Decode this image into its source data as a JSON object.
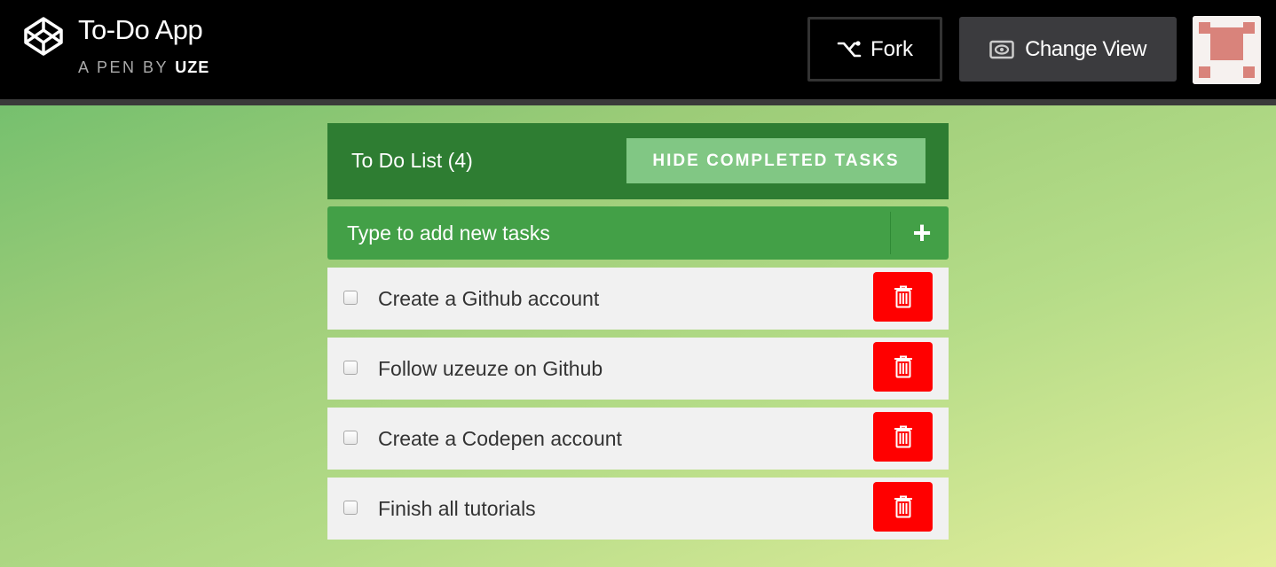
{
  "header": {
    "app_title": "To-Do App",
    "pen_by_prefix": "A PEN BY",
    "author": "UZE",
    "fork_label": "Fork",
    "change_view_label": "Change View"
  },
  "todo": {
    "title": "To Do List (4)",
    "hide_completed_label": "HIDE COMPLETED TASKS",
    "add_placeholder": "Type to add new tasks",
    "add_button_symbol": "+",
    "tasks": [
      {
        "text": "Create a Github account",
        "done": false
      },
      {
        "text": "Follow uzeuze on Github",
        "done": false
      },
      {
        "text": "Create a Codepen account",
        "done": false
      },
      {
        "text": "Finish all tutorials",
        "done": false
      }
    ]
  },
  "icons": {
    "logo": "codepen-logo-icon",
    "fork": "fork-icon",
    "change_view": "eye-icon",
    "delete": "trash-icon"
  },
  "colors": {
    "header_green": "#2e7d32",
    "hide_button": "#81c784",
    "add_row": "#43a047",
    "delete_red": "#ff0000",
    "task_bg": "#f1f1f1"
  }
}
